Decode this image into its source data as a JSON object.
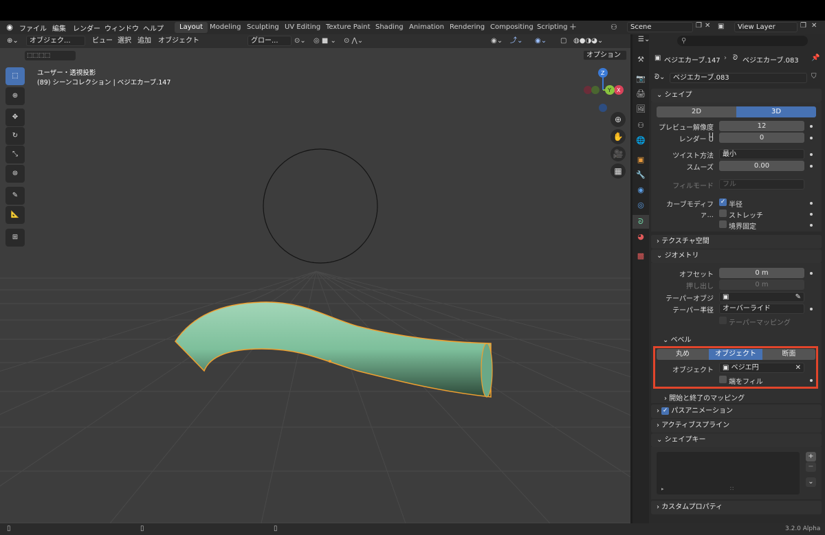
{
  "menu": [
    "ファイル",
    "編集",
    "レンダー",
    "ウィンドウ",
    "ヘルプ"
  ],
  "workspaces": [
    "Layout",
    "Modeling",
    "Sculpting",
    "UV Editing",
    "Texture Paint",
    "Shading",
    "Animation",
    "Rendering",
    "Compositing",
    "Scripting"
  ],
  "scene": "Scene",
  "view_layer": "View Layer",
  "viewport": {
    "mode": "オブジェク...",
    "menus": [
      "ビュー",
      "選択",
      "追加",
      "オブジェクト"
    ],
    "transform": "グロー...",
    "options": "オプション",
    "view_name": "ユーザー・透視投影",
    "collection_info": "(89) シーンコレクション | ベジエカーブ.147"
  },
  "props": {
    "breadcrumb_object": "ベジエカーブ.147",
    "breadcrumb_data": "ベジエカーブ.083",
    "data_name": "ベジエカーブ.083",
    "shape": {
      "title": "シェイプ",
      "dim_2d": "2D",
      "dim_3d": "3D",
      "preview_res_label": "プレビュー解像度 U",
      "preview_res": "12",
      "render_label": "レンダー U",
      "render": "0",
      "twist_label": "ツイスト方法",
      "twist": "最小",
      "smooth_label": "スムーズ",
      "smooth": "0.00",
      "fill_label": "フィルモード",
      "fill": "フル",
      "curve_mod_label": "カーブモディファ...",
      "radius": "半径",
      "stretch": "ストレッチ",
      "bounds": "境界固定"
    },
    "texture_space": "テクスチャ空間",
    "geometry": {
      "title": "ジオメトリ",
      "offset_label": "オフセット",
      "offset": "0 m",
      "extrude_label": "押し出し",
      "extrude": "0 m",
      "taper_obj_label": "テーパーオブジェ...",
      "taper_radius_label": "テーパー半径",
      "taper_radius": "オーバーライド",
      "taper_mapping": "テーパーマッピング"
    },
    "bevel": {
      "title": "ベベル",
      "round": "丸め",
      "object": "オブジェクト",
      "profile": "断面",
      "object_label": "オブジェクト",
      "object_value": "ベジエ円",
      "fill_caps": "端をフィル",
      "start_end": "開始と終了のマッピング"
    },
    "path_anim": "パスアニメーション",
    "active_spline": "アクティブスプライン",
    "shape_keys": "シェイプキー",
    "custom_props": "カスタムプロパティ"
  },
  "version": "3.2.0 Alpha",
  "highlight_color": "#e2452b",
  "accent_color": "#4772b3"
}
